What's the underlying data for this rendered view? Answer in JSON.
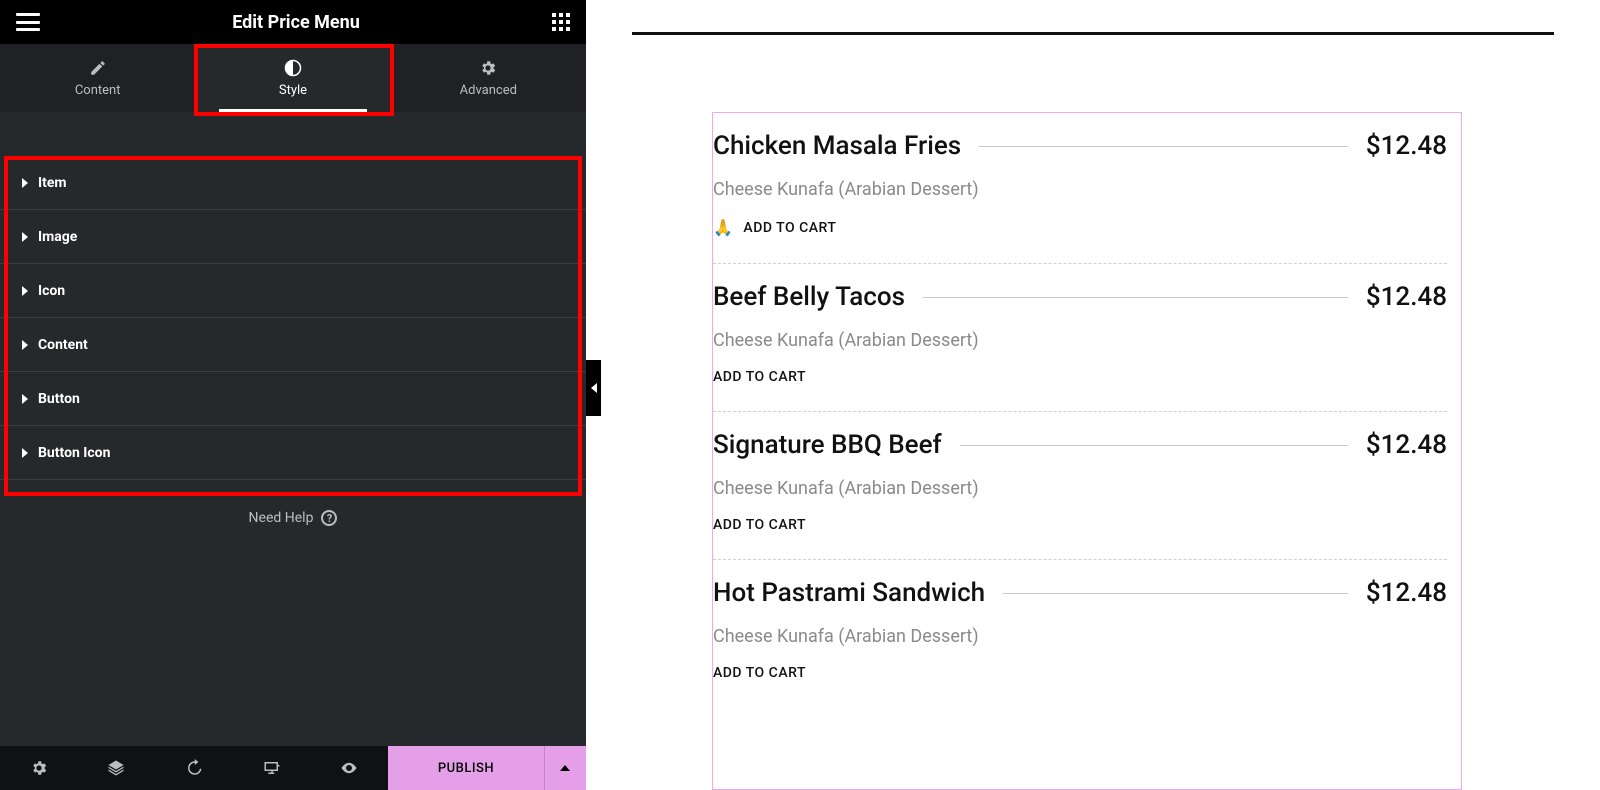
{
  "panel": {
    "title": "Edit Price Menu",
    "tabs": [
      {
        "label": "Content"
      },
      {
        "label": "Style"
      },
      {
        "label": "Advanced"
      }
    ],
    "active_tab_index": 1,
    "accordion": [
      {
        "label": "Item"
      },
      {
        "label": "Image"
      },
      {
        "label": "Icon"
      },
      {
        "label": "Content"
      },
      {
        "label": "Button"
      },
      {
        "label": "Button Icon"
      }
    ],
    "need_help": "Need Help",
    "footer": {
      "publish_label": "PUBLISH"
    }
  },
  "preview": {
    "menu_items": [
      {
        "name": "Chicken Masala Fries",
        "price": "$12.48",
        "desc": "Cheese Kunafa (Arabian Dessert)",
        "cart": "ADD TO CART",
        "show_icon": true
      },
      {
        "name": "Beef Belly Tacos",
        "price": "$12.48",
        "desc": "Cheese Kunafa (Arabian Dessert)",
        "cart": "ADD TO CART",
        "show_icon": false
      },
      {
        "name": "Signature BBQ Beef",
        "price": "$12.48",
        "desc": "Cheese Kunafa (Arabian Dessert)",
        "cart": "ADD TO CART",
        "show_icon": false
      },
      {
        "name": "Hot Pastrami Sandwich",
        "price": "$12.48",
        "desc": "Cheese Kunafa (Arabian Dessert)",
        "cart": "ADD TO CART",
        "show_icon": false
      }
    ]
  }
}
